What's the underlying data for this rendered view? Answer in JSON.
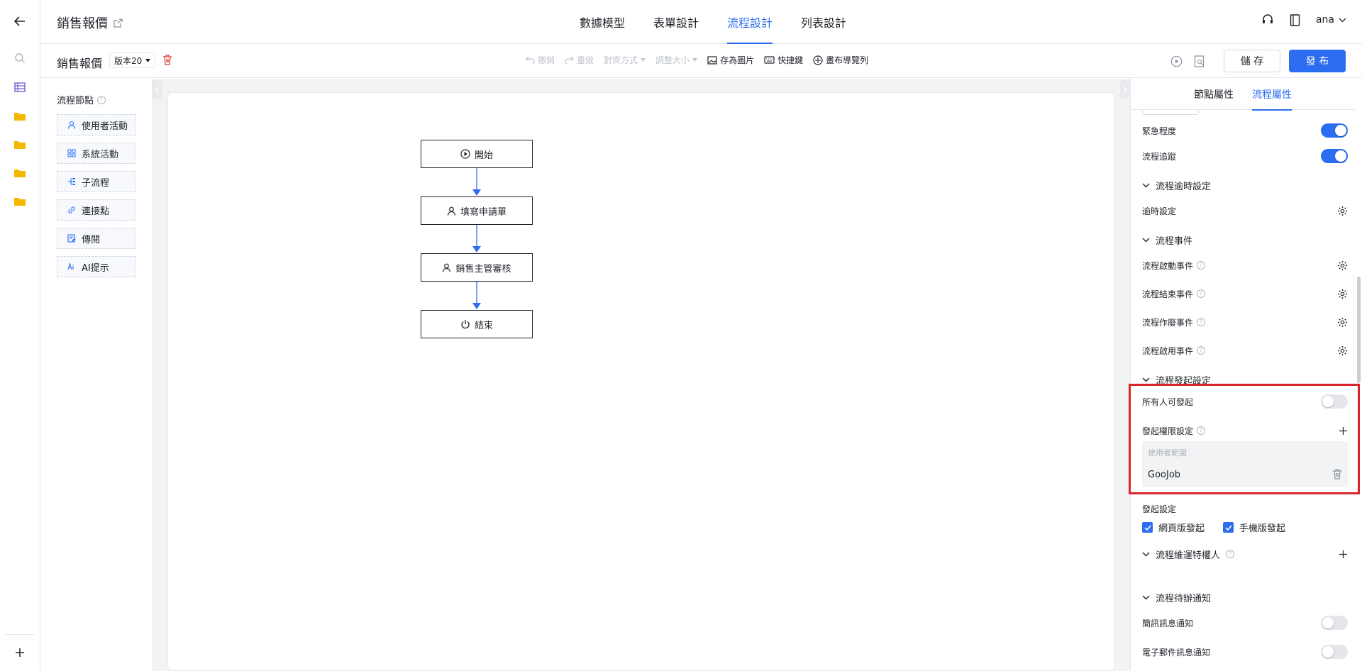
{
  "header": {
    "app_title": "銷售報價",
    "tabs": [
      {
        "label": "數據模型",
        "active": false
      },
      {
        "label": "表單設計",
        "active": false
      },
      {
        "label": "流程設計",
        "active": true
      },
      {
        "label": "列表設計",
        "active": false
      }
    ],
    "user": "ana"
  },
  "toolbar": {
    "form_name": "銷售報價",
    "version": "版本20",
    "undo": "撤銷",
    "redo": "重做",
    "align": "對齊方式",
    "resize": "調整大小",
    "save_image": "存為圖片",
    "shortcuts": "快捷鍵",
    "canvas_nav": "畫布導覽列",
    "save": "儲 存",
    "publish": "發 布"
  },
  "nodes_panel": {
    "title": "流程節點",
    "items": [
      {
        "label": "使用者活動",
        "icon": "user-icon"
      },
      {
        "label": "系統活動",
        "icon": "grid-icon"
      },
      {
        "label": "子流程",
        "icon": "subflow-icon"
      },
      {
        "label": "連接點",
        "icon": "link-icon"
      },
      {
        "label": "傳閱",
        "icon": "circulate-icon"
      },
      {
        "label": "AI提示",
        "icon": "ai-icon"
      }
    ]
  },
  "flow": {
    "nodes": [
      {
        "label": "開始",
        "icon": "play-icon"
      },
      {
        "label": "填寫申請單",
        "icon": "user-icon"
      },
      {
        "label": "銷售主管審核",
        "icon": "user-icon"
      },
      {
        "label": "結束",
        "icon": "power-icon"
      }
    ]
  },
  "right_panel": {
    "tabs": [
      {
        "label": "節點屬性",
        "active": false
      },
      {
        "label": "流程屬性",
        "active": true
      }
    ],
    "urgency": {
      "label": "緊急程度",
      "on": true
    },
    "tracking": {
      "label": "流程追蹤",
      "on": true
    },
    "timeout_section": "流程逾時設定",
    "timeout_setting": "逾時設定",
    "events_section": "流程事件",
    "events": [
      "流程啟動事件",
      "流程結束事件",
      "流程作廢事件",
      "流程啟用事件"
    ],
    "initiate_section": "流程發起設定",
    "anyone_can_initiate": {
      "label": "所有人可發起",
      "on": false
    },
    "initiate_permission": "發起權限設定",
    "user_scope_placeholder": "使用者範圍",
    "user_scope_value": "GooJob",
    "initiate_setting": "發起設定",
    "web_initiate": {
      "label": "網頁版發起",
      "checked": true
    },
    "mobile_initiate": {
      "label": "手機版發起",
      "checked": true
    },
    "maintenance_section": "流程維運特權人",
    "todo_section": "流程待辦通知",
    "sms_notify": {
      "label": "簡訊訊息通知",
      "on": false
    },
    "email_notify": {
      "label": "電子郵件訊息通知",
      "on": false
    }
  },
  "colors": {
    "accent": "#2b6cf0",
    "highlight": "#d9252a",
    "folder": "#f5b800",
    "table": "#7b5cd6"
  }
}
